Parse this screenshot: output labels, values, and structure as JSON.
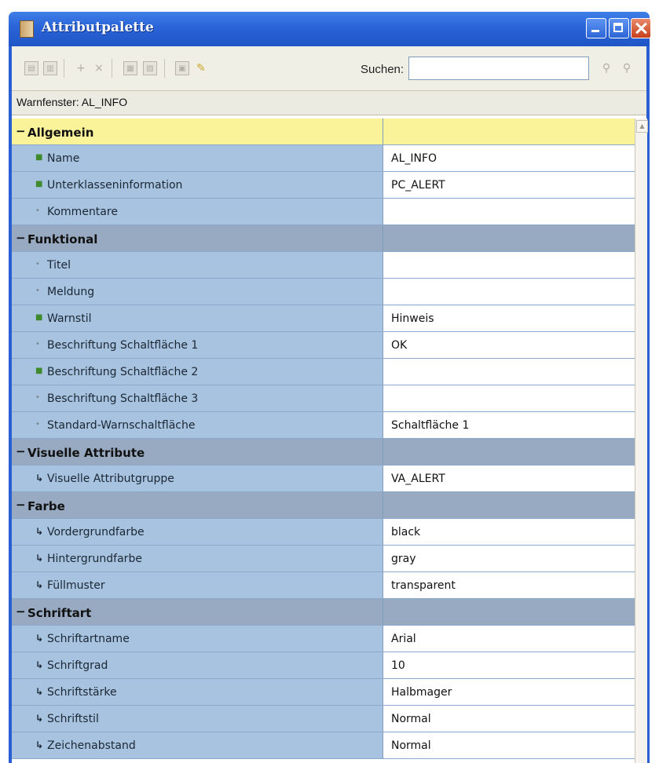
{
  "window": {
    "title": "Attributpalette"
  },
  "toolbar": {
    "search_label": "Suchen:",
    "search_value": ""
  },
  "status": {
    "text": "Warnfenster: AL_INFO"
  },
  "rows": [
    {
      "kind": "group",
      "label": "Allgemein",
      "highlight": true
    },
    {
      "kind": "prop",
      "bullet": "green",
      "label": "Name",
      "value": "AL_INFO"
    },
    {
      "kind": "prop",
      "bullet": "green",
      "label": "Unterklasseninformation",
      "value": "PC_ALERT"
    },
    {
      "kind": "prop",
      "bullet": "plain",
      "label": "Kommentare",
      "value": ""
    },
    {
      "kind": "group",
      "label": "Funktional"
    },
    {
      "kind": "prop",
      "bullet": "plain",
      "label": "Titel",
      "value": ""
    },
    {
      "kind": "prop",
      "bullet": "plain",
      "label": "Meldung",
      "value": ""
    },
    {
      "kind": "prop",
      "bullet": "green",
      "label": "Warnstil",
      "value": "Hinweis"
    },
    {
      "kind": "prop",
      "bullet": "plain",
      "label": "Beschriftung Schaltfläche 1",
      "value": "OK"
    },
    {
      "kind": "prop",
      "bullet": "green",
      "label": "Beschriftung Schaltfläche 2",
      "value": ""
    },
    {
      "kind": "prop",
      "bullet": "plain",
      "label": "Beschriftung Schaltfläche 3",
      "value": ""
    },
    {
      "kind": "prop",
      "bullet": "plain",
      "label": "Standard-Warnschaltfläche",
      "value": "Schaltfläche 1"
    },
    {
      "kind": "group",
      "label": "Visuelle Attribute"
    },
    {
      "kind": "prop",
      "bullet": "inherit",
      "label": "Visuelle Attributgruppe",
      "value": "VA_ALERT"
    },
    {
      "kind": "group",
      "label": "Farbe"
    },
    {
      "kind": "prop",
      "bullet": "inherit",
      "label": "Vordergrundfarbe",
      "value": "black"
    },
    {
      "kind": "prop",
      "bullet": "inherit",
      "label": "Hintergrundfarbe",
      "value": "gray"
    },
    {
      "kind": "prop",
      "bullet": "inherit",
      "label": "Füllmuster",
      "value": "transparent"
    },
    {
      "kind": "group",
      "label": "Schriftart"
    },
    {
      "kind": "prop",
      "bullet": "inherit",
      "label": "Schriftartname",
      "value": "Arial"
    },
    {
      "kind": "prop",
      "bullet": "inherit",
      "label": "Schriftgrad",
      "value": "10"
    },
    {
      "kind": "prop",
      "bullet": "inherit",
      "label": "Schriftstärke",
      "value": "Halbmager"
    },
    {
      "kind": "prop",
      "bullet": "inherit",
      "label": "Schriftstil",
      "value": "Normal"
    },
    {
      "kind": "prop",
      "bullet": "inherit",
      "label": "Zeichenabstand",
      "value": "Normal"
    }
  ],
  "colors": {
    "titlebar": "#2a64d8",
    "group_row": "#97aac1",
    "group_row_selected": "#fbf39a",
    "property_name_bg": "#a7c3e0"
  }
}
